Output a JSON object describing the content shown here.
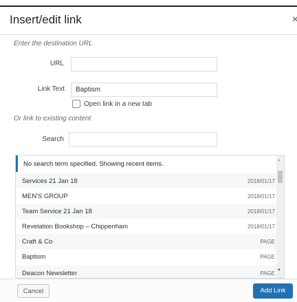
{
  "dialog": {
    "title": "Insert/edit link",
    "close_glyph": "×",
    "url_section_label": "Enter the destination URL",
    "url_label": "URL",
    "url_value": "",
    "link_text_label": "Link Text",
    "link_text_value": "Baptism",
    "new_tab_label": "Open link in a new tab",
    "new_tab_checked": false,
    "existing_section_label": "Or link to existing content",
    "search_label": "Search",
    "search_value": ""
  },
  "results": {
    "notice": "No search term specified. Showing recent items.",
    "items": [
      {
        "title": "Services 21 Jan 18",
        "meta": "2018/01/17"
      },
      {
        "title": "MEN'S GROUP",
        "meta": "2018/01/17"
      },
      {
        "title": "Team Service 21 Jan 18",
        "meta": "2018/01/17"
      },
      {
        "title": "Revelation Bookshop – Chippenham",
        "meta": "2018/01/17"
      },
      {
        "title": "Craft & Co",
        "meta": "PAGE"
      },
      {
        "title": "Baptism",
        "meta": "PAGE"
      },
      {
        "title": "Deacon Newsletter",
        "meta": "PAGE"
      }
    ]
  },
  "footer": {
    "cancel_label": "Cancel",
    "add_link_label": "Add Link"
  },
  "colors": {
    "accent": "#2271b1",
    "row_alt": "#f6f7f7"
  }
}
